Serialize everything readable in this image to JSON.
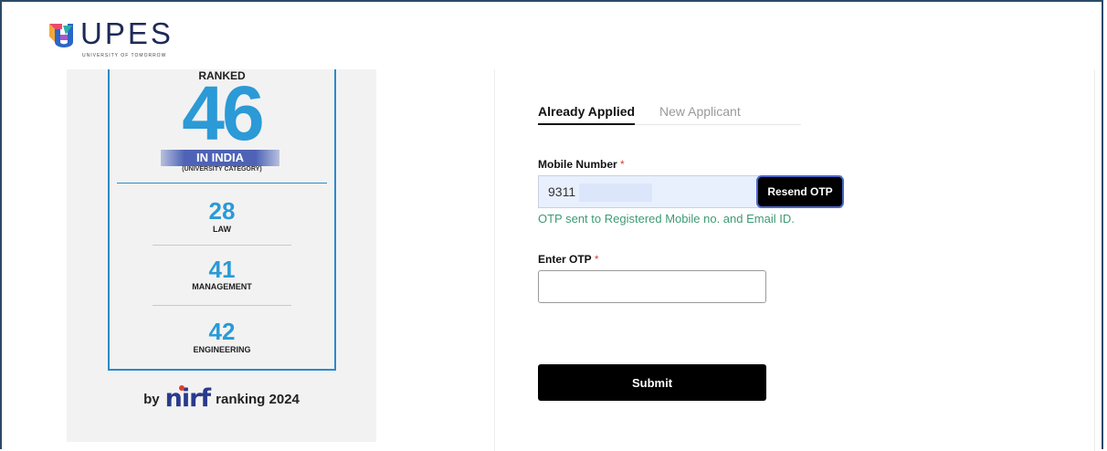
{
  "header": {
    "logo_text": "UPES",
    "logo_tagline": "UNIVERSITY OF TOMORROW"
  },
  "ranking": {
    "ranked_label": "RANKED",
    "overall_rank": "46",
    "in_india": "IN INDIA",
    "category_note": "(UNIVERSITY CATEGORY)",
    "categories": [
      {
        "rank": "28",
        "name": "LAW"
      },
      {
        "rank": "41",
        "name": "MANAGEMENT"
      },
      {
        "rank": "42",
        "name": "ENGINEERING"
      }
    ],
    "by_prefix": "by",
    "brand": "nirf",
    "suffix": "ranking 2024"
  },
  "form": {
    "tabs": [
      {
        "label": "Already Applied",
        "active": true
      },
      {
        "label": "New Applicant",
        "active": false
      }
    ],
    "mobile_label": "Mobile Number",
    "required_mark": "*",
    "mobile_value": "9311",
    "resend_label": "Resend OTP",
    "otp_message": "OTP sent to Registered Mobile no. and Email ID.",
    "otp_label": "Enter OTP",
    "otp_placeholder": "",
    "submit_label": "Submit"
  },
  "colors": {
    "accent_blue": "#2b9ad6",
    "brand_navy": "#1d2a57",
    "success_green": "#3e9a74",
    "required_red": "#e23b2e"
  }
}
